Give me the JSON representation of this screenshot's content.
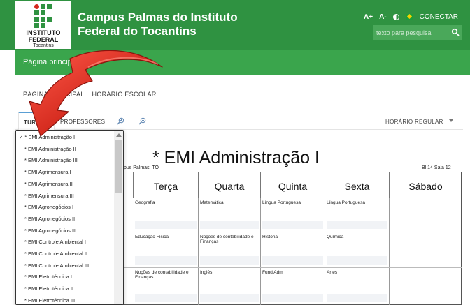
{
  "header": {
    "logo": {
      "line1": "INSTITUTO",
      "line2": "FEDERAL",
      "line3": "Tocantins"
    },
    "site_title": "Campus Palmas do Instituto Federal do Tocantins",
    "tools": {
      "font_increase": "A+",
      "font_decrease": "A-",
      "contrast_icon": "contrast-icon",
      "flag_icon": "brazil-flag-icon"
    },
    "connect_label": "CONECTAR",
    "search": {
      "placeholder": "texto para pesquisa",
      "icon": "search-icon"
    },
    "colors": {
      "header_green": "#2f9241",
      "nav_green": "#3aa54c",
      "arrow_red": "#d42a1e"
    }
  },
  "nav": {
    "items": [
      {
        "label": "Página principal"
      }
    ]
  },
  "breadcrumb": "PÁGINA PRINCIPAL    HORÁRIO ESCOLAR",
  "tabs": {
    "turmas": "TURMAS",
    "professores": "PROFESSORES",
    "zoom_in_icon": "zoom-in-icon",
    "zoom_out_icon": "zoom-out-icon",
    "horario_select": "HORÁRIO REGULAR"
  },
  "schedule": {
    "title": "* EMI Administração I",
    "location": "pus Palmas, TO",
    "room": "Bl 14 Sala 12",
    "days": [
      "Terça",
      "Quarta",
      "Quinta",
      "Sexta",
      "Sábado"
    ],
    "rows": [
      [
        "Geografia",
        "Matemática",
        "Língua Portuguesa",
        "Língua Portuguesa",
        ""
      ],
      [
        "Educação Física",
        "Noções de contabilidade e Finanças",
        "História",
        "Química",
        ""
      ],
      [
        "Noções de contabilidade e Finanças",
        "Inglês",
        "Fund Adm",
        "Artes",
        ""
      ]
    ]
  },
  "dropdown": {
    "items": [
      {
        "label": "* EMI Administração I",
        "selected": true
      },
      {
        "label": "* EMI Administração II",
        "selected": false
      },
      {
        "label": "* EMI Administração III",
        "selected": false
      },
      {
        "label": "* EMI Agrimensura I",
        "selected": false
      },
      {
        "label": "* EMI Agrimensura II",
        "selected": false
      },
      {
        "label": "* EMI Agrimensura III",
        "selected": false
      },
      {
        "label": "* EMI Agronegócios I",
        "selected": false
      },
      {
        "label": "* EMI Agronegócios II",
        "selected": false
      },
      {
        "label": "* EMI Agronegócios III",
        "selected": false
      },
      {
        "label": "* EMI Controle Ambiental I",
        "selected": false
      },
      {
        "label": "* EMI Controle Ambiental II",
        "selected": false
      },
      {
        "label": "* EMI Controle Ambiental III",
        "selected": false
      },
      {
        "label": "* EMI Eletrotécnica I",
        "selected": false
      },
      {
        "label": "* EMI Eletrotécnica II",
        "selected": false
      },
      {
        "label": "* EMI Eletrotécnica III",
        "selected": false
      }
    ],
    "check_mark": "✓"
  }
}
